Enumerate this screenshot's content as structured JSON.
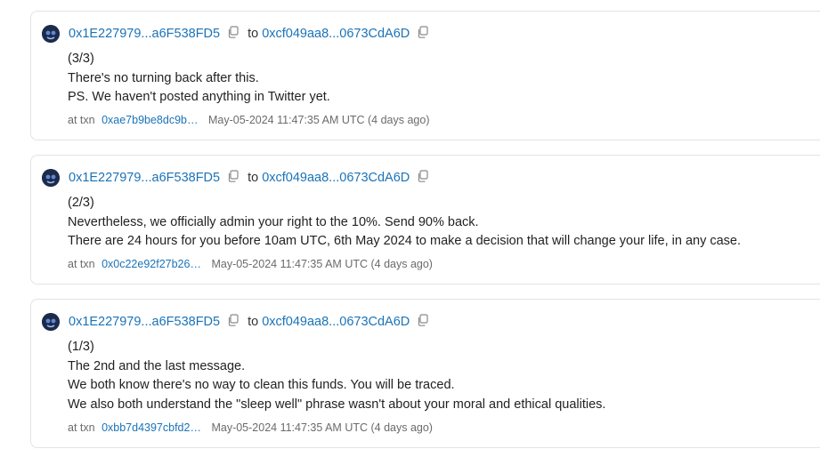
{
  "messages": [
    {
      "from": "0x1E227979...a6F538FD5",
      "to_label": "to",
      "to": "0xcf049aa8...0673CdA6D",
      "lines": [
        "(3/3)",
        "There's no turning back after this.",
        "PS. We haven't posted anything in Twitter yet."
      ],
      "txn_prefix": "at txn",
      "txn": "0xae7b9be8dc9b…",
      "date": "May-05-2024 11:47:35 AM UTC (4 days ago)"
    },
    {
      "from": "0x1E227979...a6F538FD5",
      "to_label": "to",
      "to": "0xcf049aa8...0673CdA6D",
      "lines": [
        "(2/3)",
        "Nevertheless, we officially admin your right to the 10%. Send 90% back.",
        "There are 24 hours for you before 10am UTC, 6th May 2024 to make a decision that will change your life, in any case."
      ],
      "txn_prefix": "at txn",
      "txn": "0x0c22e92f27b26…",
      "date": "May-05-2024 11:47:35 AM UTC (4 days ago)"
    },
    {
      "from": "0x1E227979...a6F538FD5",
      "to_label": "to",
      "to": "0xcf049aa8...0673CdA6D",
      "lines": [
        "(1/3)",
        "The 2nd and the last message.",
        "We both know there's no way to clean this funds. You will be traced.",
        "We also both understand the \"sleep well\" phrase wasn't about your moral and ethical qualities."
      ],
      "txn_prefix": "at txn",
      "txn": "0xbb7d4397cbfd2…",
      "date": "May-05-2024 11:47:35 AM UTC (4 days ago)"
    }
  ],
  "icons": {
    "avatar": "avatar-icon",
    "copy": "copy-icon"
  },
  "colors": {
    "link": "#1a73b8",
    "text": "#222222",
    "muted": "#6b6b6b",
    "border": "#e3e3e3"
  }
}
